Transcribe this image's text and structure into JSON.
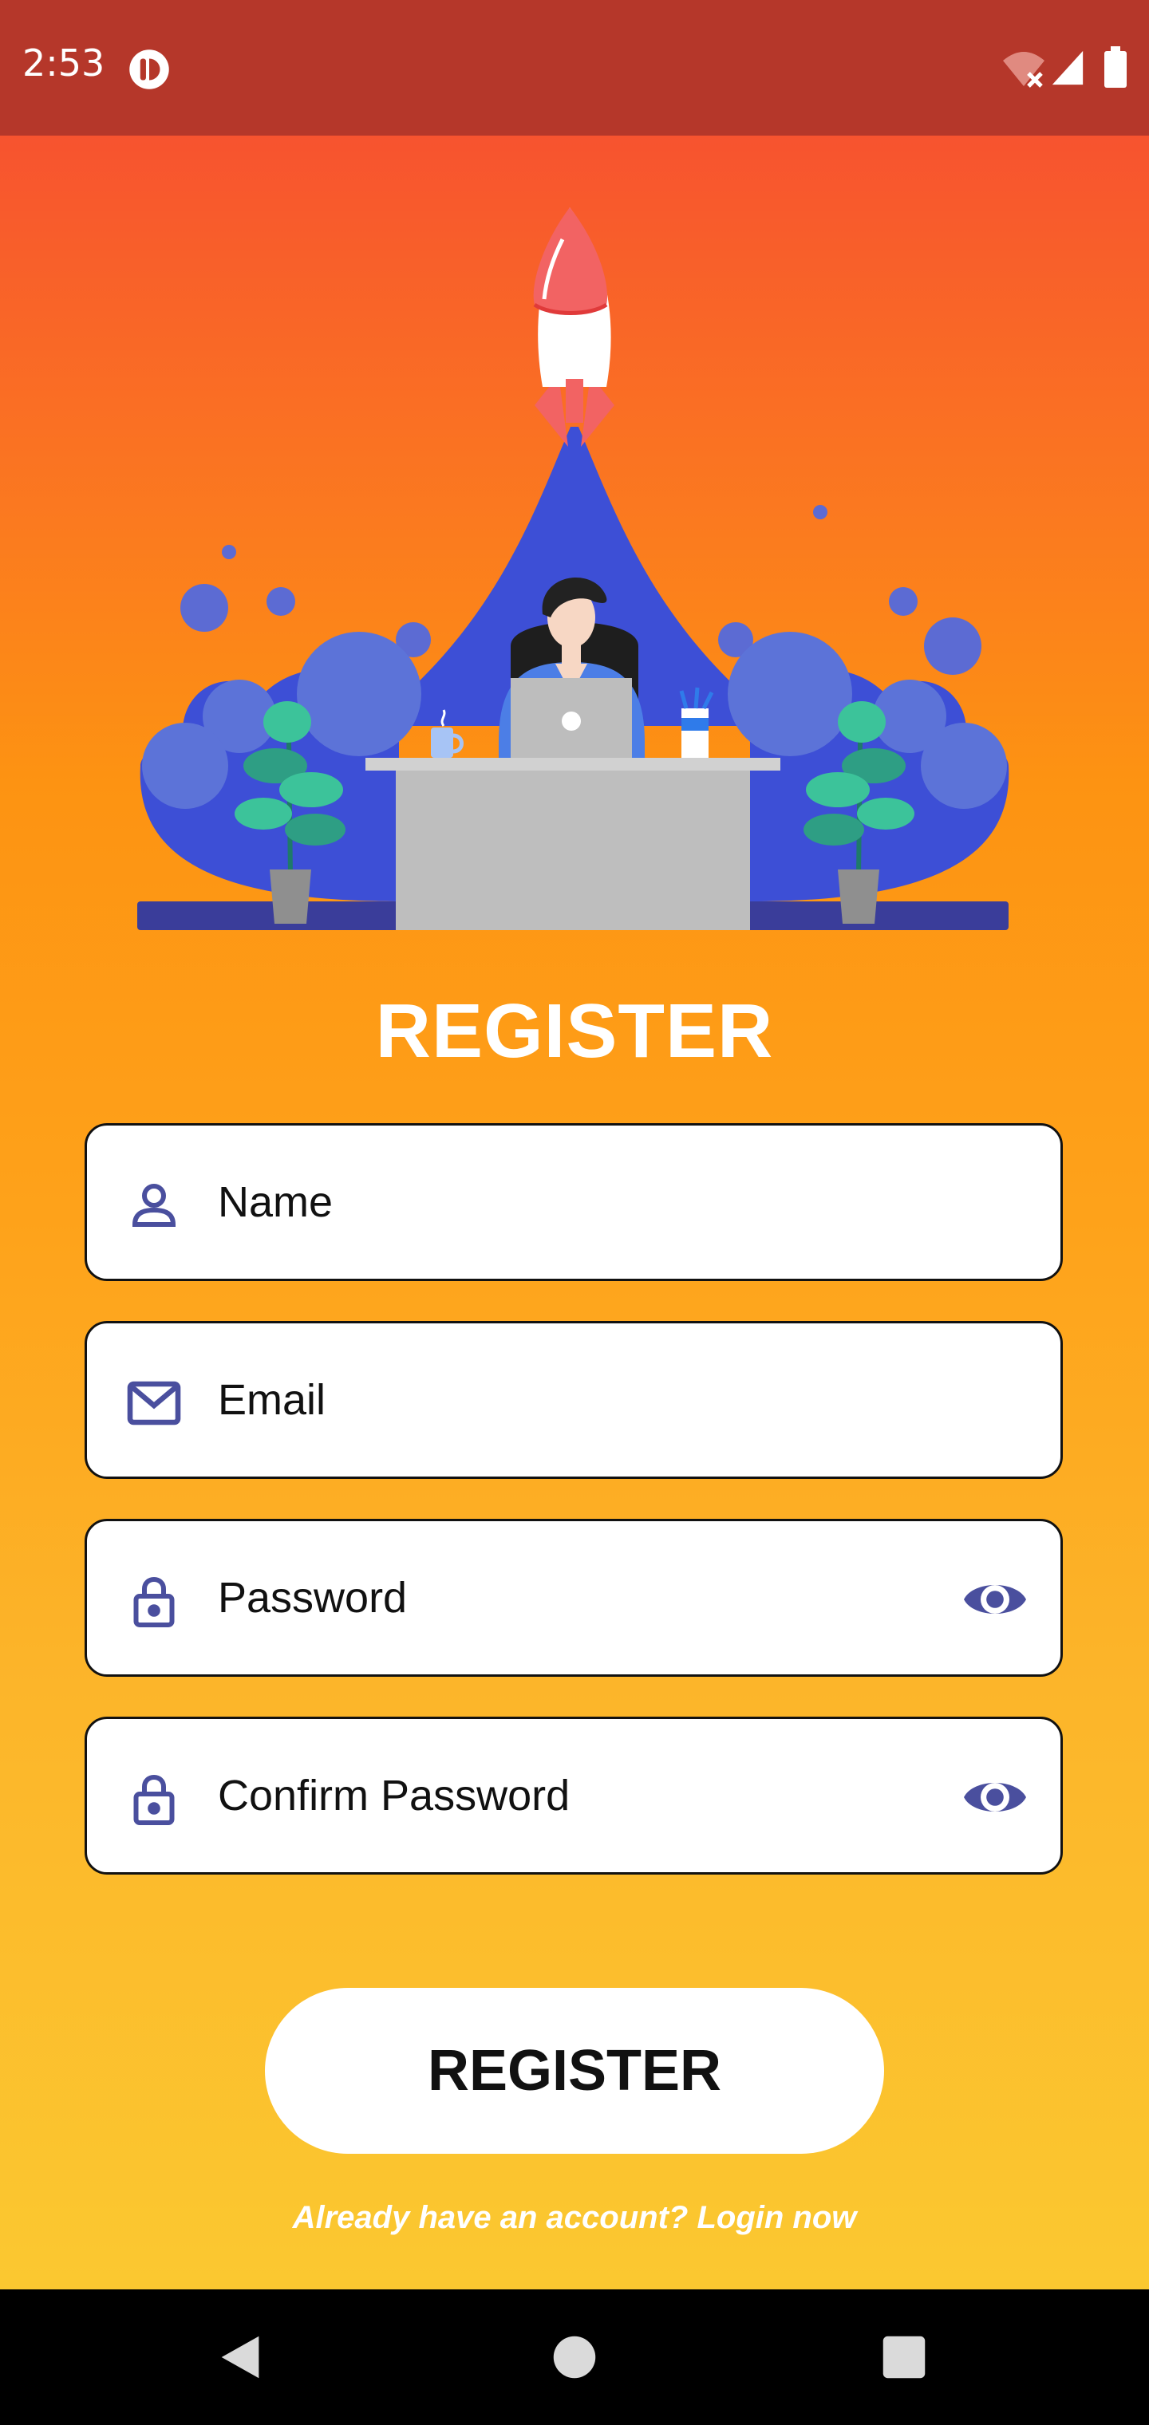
{
  "status_bar": {
    "time": "2:53",
    "icons": [
      "app-notification-icon",
      "wifi-off-icon",
      "cell-signal-icon",
      "battery-icon"
    ]
  },
  "illustration": {
    "name": "rocket-launch-desk-illustration"
  },
  "page": {
    "title": "REGISTER"
  },
  "form": {
    "name": {
      "placeholder": "Name",
      "value": "",
      "icon": "person-icon"
    },
    "email": {
      "placeholder": "Email",
      "value": "",
      "icon": "mail-icon"
    },
    "password": {
      "placeholder": "Password",
      "value": "",
      "icon": "lock-icon",
      "toggle_icon": "eye-icon"
    },
    "confirm_password": {
      "placeholder": "Confirm Password",
      "value": "",
      "icon": "lock-icon",
      "toggle_icon": "eye-icon"
    }
  },
  "actions": {
    "register_label": "REGISTER",
    "login_prompt": "Already have an account? Login now"
  },
  "navigation": {
    "buttons": [
      "back-icon",
      "home-icon",
      "recents-icon"
    ]
  },
  "colors": {
    "status_bar": "#B5372A",
    "gradient_top": "#F7532F",
    "gradient_bottom": "#FBC830",
    "icon_accent": "#4A4F9E",
    "illustration_blue": "#3D4FD6"
  }
}
